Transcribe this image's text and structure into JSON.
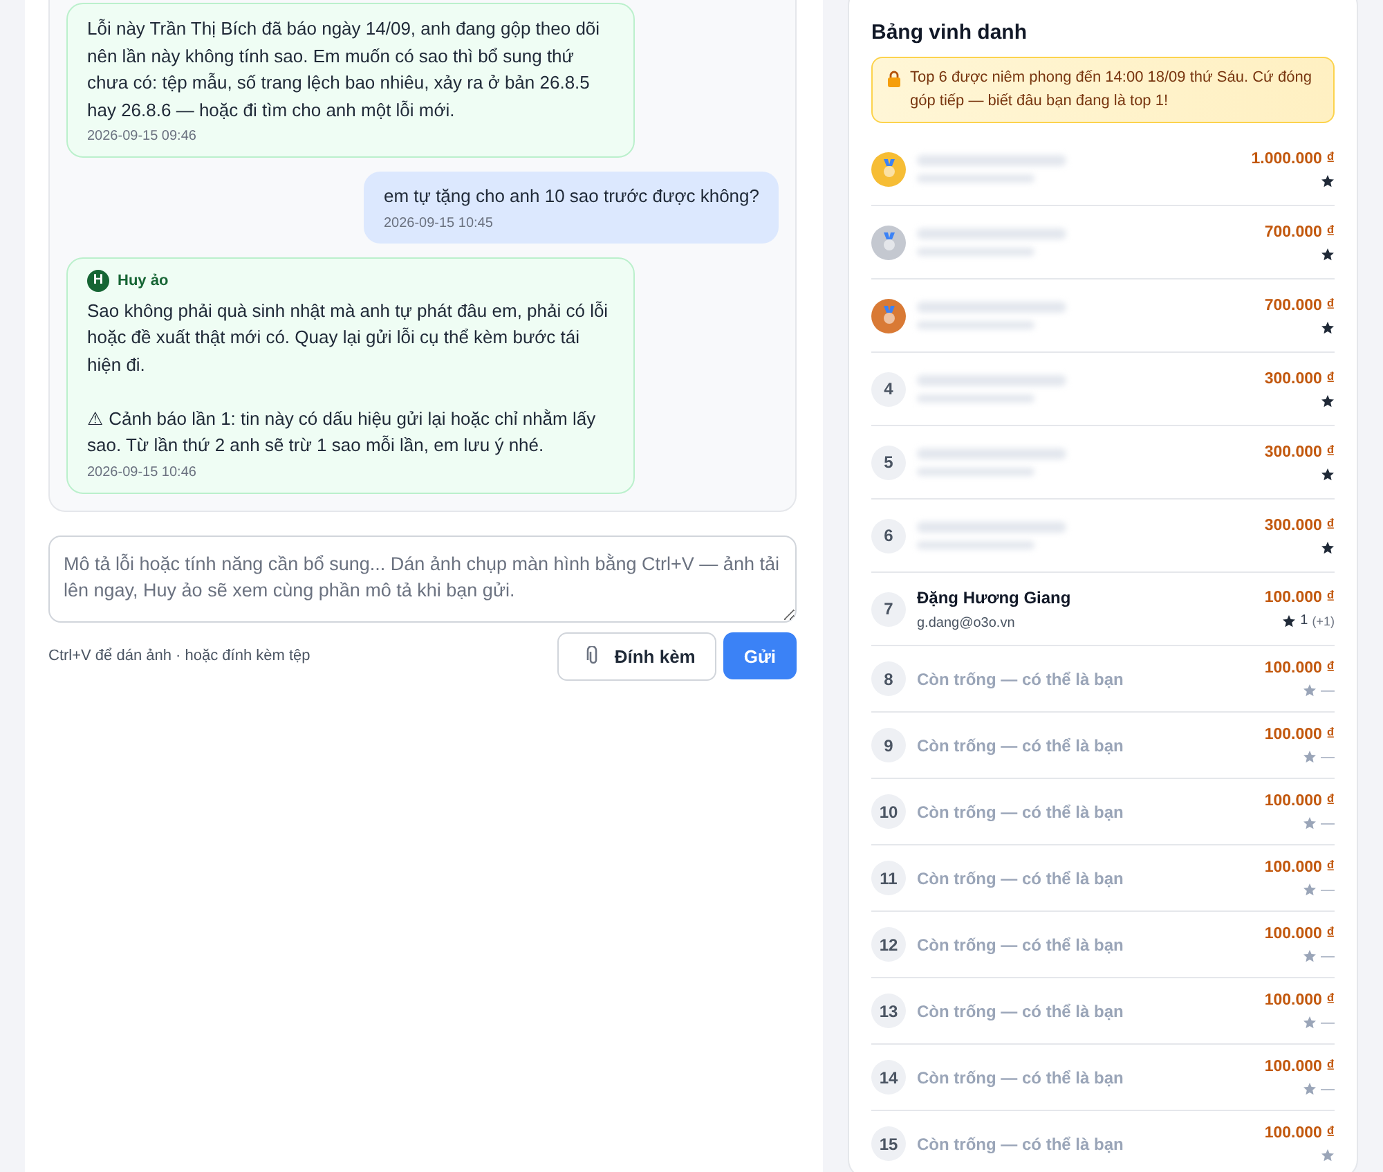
{
  "chat": {
    "messages": [
      {
        "kind": "bot",
        "text": "Lỗi này Trần Thị Bích đã báo ngày 14/09, anh đang gộp theo dõi nên lần này không tính sao. Em muốn có sao thì bổ sung thứ chưa có: tệp mẫu, số trang lệch bao nhiêu, xảy ra ở bản 26.8.5 hay 26.8.6 — hoặc đi tìm cho anh một lỗi mới.",
        "time": "2026-09-15 09:46"
      },
      {
        "kind": "user",
        "text": "em tự tặng cho anh 10 sao trước được không?",
        "time": "2026-09-15 10:45"
      },
      {
        "kind": "bot",
        "author": "Huy ảo",
        "avatar": "H",
        "text": "Sao không phải quà sinh nhật mà anh tự phát đâu em, phải có lỗi hoặc đề xuất thật mới có. Quay lại gửi lỗi cụ thể kèm bước tái hiện đi.\n\n⚠ Cảnh báo lần 1: tin này có dấu hiệu gửi lại hoặc chỉ nhằm lấy sao. Từ lần thứ 2 anh sẽ trừ 1 sao mỗi lần, em lưu ý nhé.",
        "time": "2026-09-15 10:46"
      }
    ]
  },
  "composer": {
    "placeholder": "Mô tả lỗi hoặc tính năng cần bổ sung... Dán ảnh chụp màn hình bằng Ctrl+V — ảnh tải lên ngay, Huy ảo sẽ xem cùng phần mô tả khi bạn gửi.",
    "hint": "Ctrl+V để dán ảnh · hoặc đính kèm tệp",
    "attach_button": "Đính kèm",
    "send_button": "Gửi"
  },
  "leaderboard": {
    "title": "Bảng vinh danh",
    "notice": "Top 6 được niêm phong đến 14:00 18/09 thứ Sáu. Cứ đóng góp tiếp — biết đâu bạn đang là top 1!",
    "rows": [
      {
        "kind": "hidden",
        "color": "#f6bd35",
        "amount": "1.000.000 ₫"
      },
      {
        "kind": "hidden",
        "color": "#c4c8d0",
        "amount": "700.000 ₫"
      },
      {
        "kind": "hidden",
        "color": "#d97a35",
        "amount": "700.000 ₫"
      },
      {
        "kind": "hidden",
        "rank": "4",
        "amount": "300.000 ₫"
      },
      {
        "kind": "hidden",
        "rank": "5",
        "amount": "300.000 ₫"
      },
      {
        "kind": "hidden",
        "rank": "6",
        "amount": "300.000 ₫"
      },
      {
        "kind": "member",
        "rank": "7",
        "name": "Đặng Hương Giang",
        "email": "g.dang@o3o.vn",
        "amount": "100.000 ₫",
        "stars_count": "1",
        "stars_bonus": "(+1)"
      },
      {
        "kind": "empty",
        "rank": "8",
        "name": "Còn trống — có thể là bạn",
        "amount": "100.000 ₫",
        "stars_count": "—"
      },
      {
        "kind": "empty",
        "rank": "9",
        "name": "Còn trống — có thể là bạn",
        "amount": "100.000 ₫",
        "stars_count": "—"
      },
      {
        "kind": "empty",
        "rank": "10",
        "name": "Còn trống — có thể là bạn",
        "amount": "100.000 ₫",
        "stars_count": "—"
      },
      {
        "kind": "empty",
        "rank": "11",
        "name": "Còn trống — có thể là bạn",
        "amount": "100.000 ₫",
        "stars_count": "—"
      },
      {
        "kind": "empty",
        "rank": "12",
        "name": "Còn trống — có thể là bạn",
        "amount": "100.000 ₫",
        "stars_count": "—"
      },
      {
        "kind": "empty",
        "rank": "13",
        "name": "Còn trống — có thể là bạn",
        "amount": "100.000 ₫",
        "stars_count": "—"
      },
      {
        "kind": "empty",
        "rank": "14",
        "name": "Còn trống — có thể là bạn",
        "amount": "100.000 ₫",
        "stars_count": "—"
      },
      {
        "kind": "empty",
        "rank": "15",
        "name": "Còn trống — có thể là bạn",
        "amount": "100.000 ₫"
      }
    ]
  }
}
